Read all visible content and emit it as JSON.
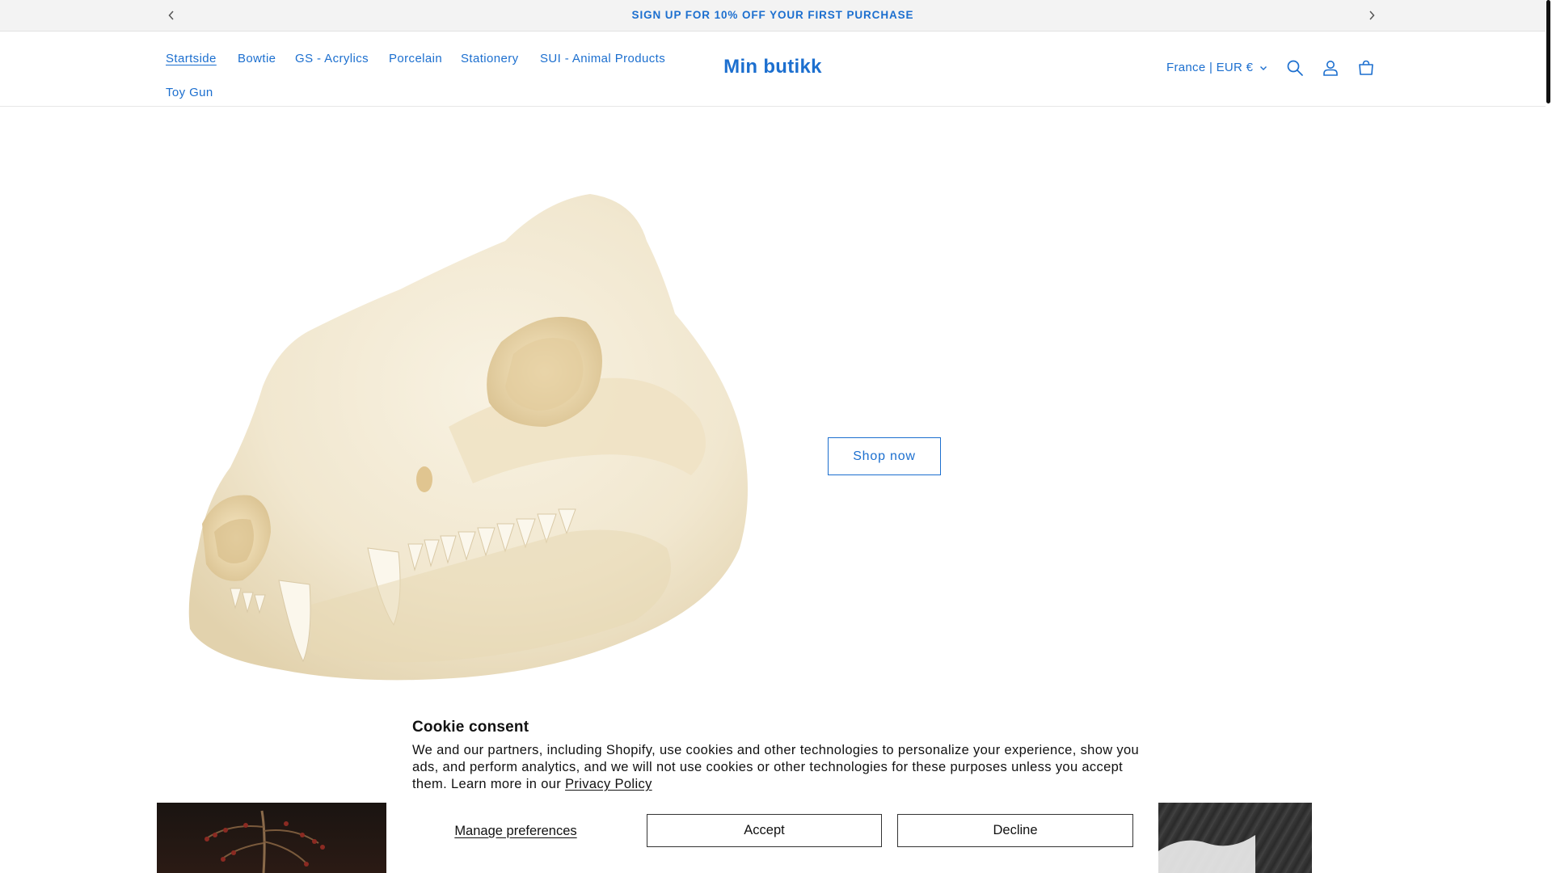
{
  "announcement": {
    "message": "SIGN UP FOR 10% OFF YOUR FIRST PURCHASE",
    "prev_icon": "chevron-left-icon",
    "next_icon": "chevron-right-icon"
  },
  "header": {
    "nav": [
      {
        "label": "Startside",
        "active": true
      },
      {
        "label": "Bowtie",
        "active": false
      },
      {
        "label": "GS - Acrylics",
        "active": false
      },
      {
        "label": "Porcelain",
        "active": false
      },
      {
        "label": "Stationery",
        "active": false
      },
      {
        "label": "SUI - Animal Products",
        "active": false
      },
      {
        "label": "Toy Gun",
        "active": false
      }
    ],
    "logo": "Min butikk",
    "locale": "France | EUR €",
    "icons": [
      "search-icon",
      "account-icon",
      "cart-icon"
    ]
  },
  "hero": {
    "button_label": "Shop now"
  },
  "cookie": {
    "title": "Cookie consent",
    "description": "We and our partners, including Shopify, use cookies and other technologies to personalize your experience, show you ads, and perform analytics, and we will not use cookies or other technologies for these purposes unless you accept them. Learn more in our ",
    "policy_link": "Privacy Policy",
    "manage_label": "Manage preferences",
    "accept_label": "Accept",
    "decline_label": "Decline"
  },
  "colors": {
    "accent": "#1c6fcf",
    "announcement_bg": "#f3f3f3"
  }
}
